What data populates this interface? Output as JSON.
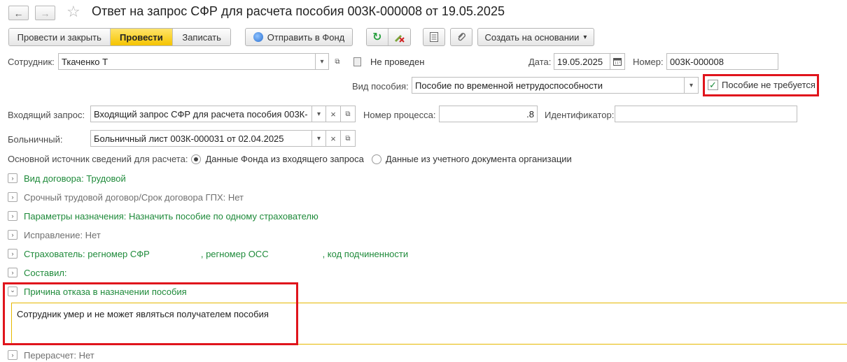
{
  "header": {
    "back_arrow": "←",
    "forward_arrow": "→",
    "star": "☆",
    "title": "Ответ на запрос СФР для расчета пособия 003К-000008 от 19.05.2025"
  },
  "toolbar": {
    "post_close": "Провести и закрыть",
    "post": "Провести",
    "save": "Записать",
    "send_fund": "Отправить в Фонд",
    "create_based": "Создать на основании",
    "refresh_icon": "↻",
    "create_based_arrow": "▾"
  },
  "form": {
    "employee_label": "Сотрудник:",
    "employee_value": "Ткаченко Т",
    "status_text": "Не проведен",
    "date_label": "Дата:",
    "date_value": "19.05.2025",
    "number_label": "Номер:",
    "number_value": "003К-000008",
    "benefit_type_label": "Вид пособия:",
    "benefit_type_value": "Пособие по временной нетрудоспособности",
    "no_benefit_label": "Пособие не требуется",
    "no_benefit_checked": true,
    "incoming_label": "Входящий запрос:",
    "incoming_value": "Входящий запрос СФР для расчета пособия 003К-",
    "process_label": "Номер процесса:",
    "process_value": ".8",
    "identifier_label": "Идентификатор:",
    "identifier_value": "",
    "sick_label": "Больничный:",
    "sick_value": "Больничный лист 003К-000031 от 02.04.2025",
    "source_label": "Основной источник сведений для расчета:",
    "source_option1": "Данные Фонда из входящего запроса",
    "source_option2": "Данные из учетного документа организации",
    "dropdown_arrow": "▾",
    "clear_x": "×",
    "open_icon": "⧉"
  },
  "groups": {
    "contract": "Вид договора: Трудовой",
    "fixed_term": "Срочный трудовой договор/Срок договора ГПХ: Нет",
    "params": "Параметры назначения: Назначить пособие по одному страхователю",
    "correction": "Исправление: Нет",
    "insurer_a": "Страхователь: регномер СФР",
    "insurer_b": ", регномер ОСС",
    "insurer_c": ", код подчиненности",
    "composed": "Составил:",
    "refusal": "Причина отказа в назначении пособия",
    "refusal_text": "Сотрудник умер и не может являться получателем пособия",
    "recalc": "Перерасчет: Нет",
    "chev_closed": "›",
    "chev_open": "⌄"
  },
  "colors": {
    "accent_yellow": "#f5c400",
    "green_text": "#1e8a3a",
    "highlight_red": "#e0141c",
    "text_area_border": "#e6b800"
  }
}
